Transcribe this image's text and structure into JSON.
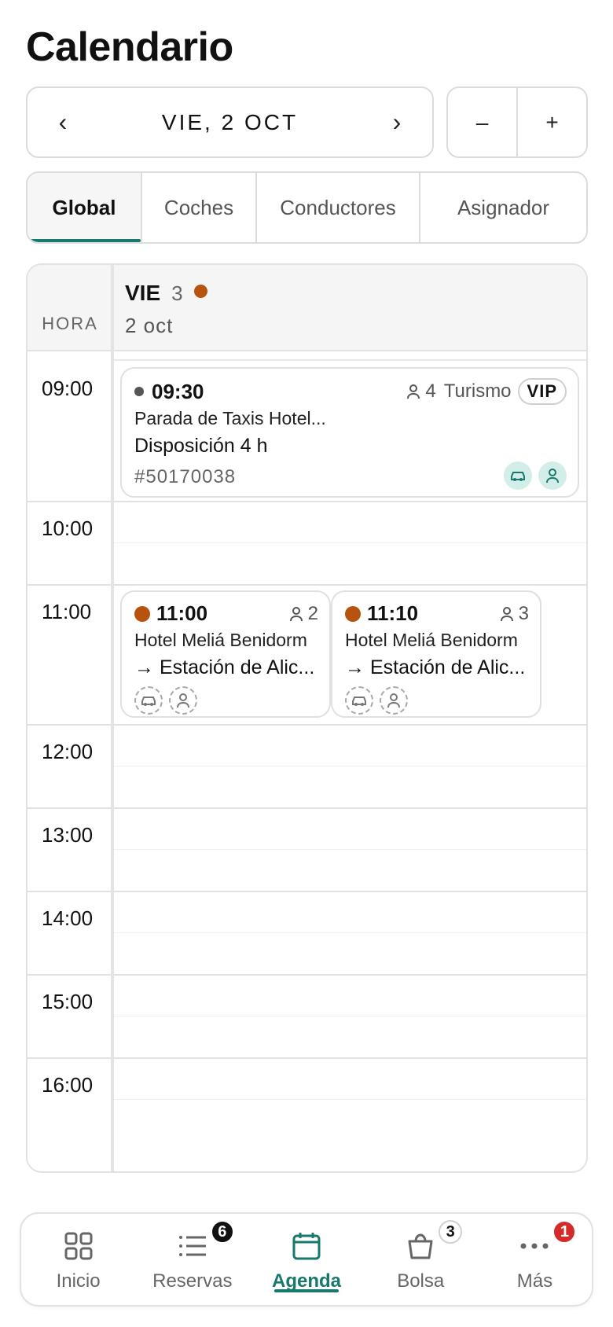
{
  "header": {
    "title": "Calendario"
  },
  "date_nav": {
    "prev": "‹",
    "date": "VIE, 2 OCT",
    "next": "›"
  },
  "zoom": {
    "minus": "–",
    "plus": "+"
  },
  "tabs": [
    {
      "label": "Global",
      "active": true
    },
    {
      "label": "Coches"
    },
    {
      "label": "Conductores"
    },
    {
      "label": "Asignador"
    }
  ],
  "calendar": {
    "hora_label": "HORA",
    "day": {
      "name": "VIE",
      "count": "3",
      "date": "2 oct",
      "dot_color": "#b5530f"
    },
    "hours": [
      "09:00",
      "10:00",
      "11:00",
      "12:00",
      "13:00",
      "14:00",
      "15:00",
      "16:00"
    ],
    "events": [
      {
        "time": "09:30",
        "status_color": "#555555",
        "pax": "4",
        "vehicle_type": "Turismo",
        "tag": "VIP",
        "line1": "Parada de Taxis Hotel...",
        "line2": "Disposición 4 h",
        "ref": "#50170038",
        "car_assigned": true,
        "driver_assigned": true
      },
      {
        "time": "11:00",
        "status_color": "#b5530f",
        "pax": "2",
        "line1": "Hotel Meliá Benidorm",
        "line2": "→ Estación de Alic...",
        "car_assigned": false,
        "driver_assigned": false
      },
      {
        "time": "11:10",
        "status_color": "#b5530f",
        "pax": "3",
        "line1": "Hotel Meliá Benidorm",
        "line2": "→ Estación de Alic...",
        "car_assigned": false,
        "driver_assigned": false
      }
    ]
  },
  "tabbar": {
    "items": [
      {
        "label": "Inicio",
        "icon": "grid-icon"
      },
      {
        "label": "Reservas",
        "icon": "list-icon",
        "badge": "6"
      },
      {
        "label": "Agenda",
        "icon": "calendar-icon",
        "active": true
      },
      {
        "label": "Bolsa",
        "icon": "bag-icon",
        "badge": "3"
      },
      {
        "label": "Más",
        "icon": "more-icon",
        "badge": "1"
      }
    ]
  },
  "colors": {
    "accent": "#17786b",
    "orange": "#b5530f",
    "badge_red": "#d42a2a"
  }
}
